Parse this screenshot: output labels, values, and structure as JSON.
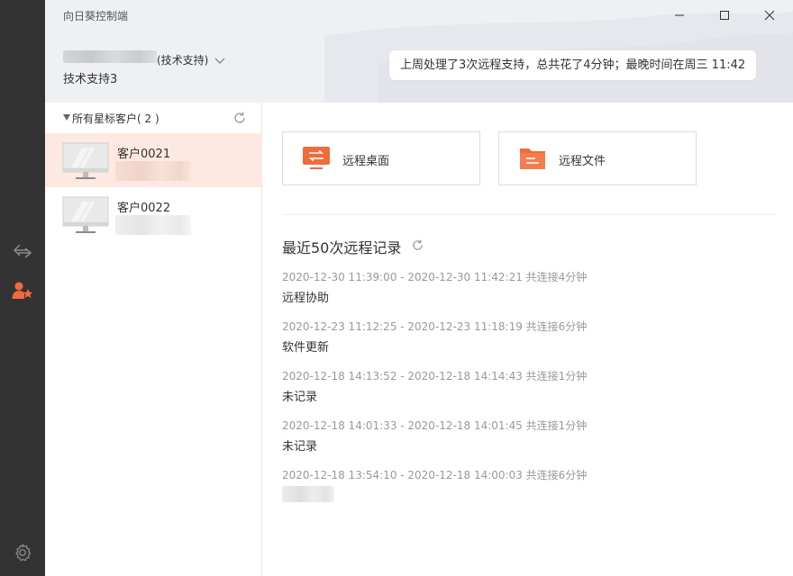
{
  "window": {
    "title": "向日葵控制端"
  },
  "user": {
    "role": "(技术支持)",
    "name": "技术支持3"
  },
  "summary": {
    "text": "上周处理了3次远程支持，总共花了4分钟；最晚时间在周三 11:42"
  },
  "group": {
    "label": "所有星标客户",
    "count": "( 2 )"
  },
  "clients": [
    {
      "name": "客户0021"
    },
    {
      "name": "客户0022"
    }
  ],
  "actions": {
    "remote_desktop": "远程桌面",
    "remote_file": "远程文件"
  },
  "records": {
    "title": "最近50次远程记录",
    "items": [
      {
        "time": "2020-12-30 11:39:00 - 2020-12-30 11:42:21 共连接4分钟",
        "desc": "远程协助"
      },
      {
        "time": "2020-12-23 11:12:25 - 2020-12-23 11:18:19 共连接6分钟",
        "desc": "软件更新"
      },
      {
        "time": "2020-12-18 14:13:52 - 2020-12-18 14:14:43 共连接1分钟",
        "desc": "未记录"
      },
      {
        "time": "2020-12-18 14:01:33 - 2020-12-18 14:01:45 共连接1分钟",
        "desc": "未记录"
      },
      {
        "time": "2020-12-18 13:54:10 - 2020-12-18 14:00:03 共连接6分钟",
        "desc": ""
      }
    ]
  },
  "colors": {
    "accent": "#f26b3a",
    "rail": "#333333",
    "header_bg": "#eef0f4",
    "selected_row": "#fde9e1"
  }
}
